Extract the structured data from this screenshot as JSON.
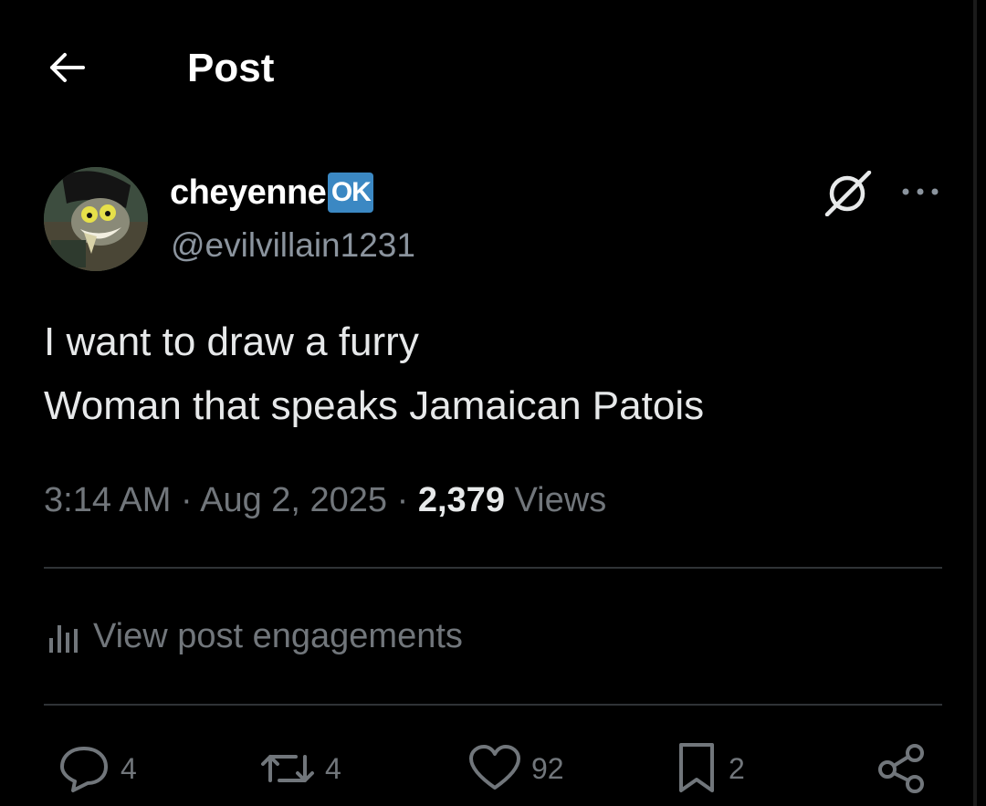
{
  "header": {
    "title": "Post"
  },
  "author": {
    "display_name": "cheyenne",
    "badge": "OK",
    "handle": "@evilvillain1231"
  },
  "post": {
    "lines": [
      "I want to draw a furry",
      "Woman that speaks Jamaican Patois"
    ],
    "time": "3:14 AM",
    "date": "Aug 2, 2025",
    "views_count": "2,379",
    "views_label": "Views",
    "separator": " · "
  },
  "engagements": {
    "label": "View post engagements"
  },
  "actions": {
    "replies": "4",
    "reposts": "4",
    "likes": "92",
    "bookmarks": "2"
  },
  "icons": {
    "back": "arrow-left-icon",
    "grok": "grok-icon",
    "more": "more-horizontal-icon",
    "engagements": "bar-chart-icon",
    "reply": "reply-icon",
    "repost": "repost-icon",
    "like": "heart-icon",
    "bookmark": "bookmark-icon",
    "share": "share-icon"
  },
  "colors": {
    "background": "#000000",
    "text": "#e7e9ea",
    "muted": "#71767b",
    "badge": "#3b88c3",
    "divider": "#2f3336"
  }
}
